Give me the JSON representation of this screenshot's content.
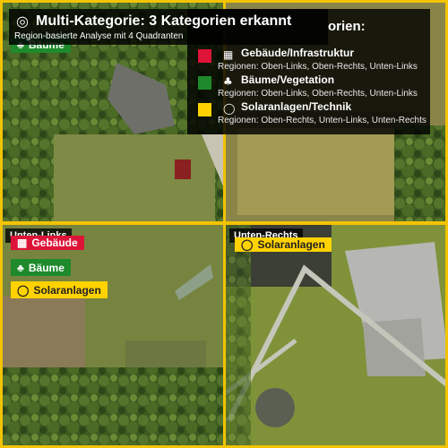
{
  "banner": {
    "title": "Multi-Kategorie: 3 Kategorien erkannt",
    "subtitle": "Region-basierte Analyse mit 4 Quadranten",
    "icon": "target-icon"
  },
  "legend": {
    "heading": "orien:",
    "items": [
      {
        "name": "Gebäude/Infrastruktur",
        "regions": "Regionen: Oben-Links, Oben-Rechts, Unten-Links",
        "color": "#dd1438",
        "icon": "building-icon"
      },
      {
        "name": "Bäume/Vegetation",
        "regions": "Regionen: Oben-Links, Oben-Rechts, Unten-Links",
        "color": "#1e8a2c",
        "icon": "tree-icon"
      },
      {
        "name": "Solaranlagen/Technik",
        "regions": "Regionen: Oben-Rechts, Unten-Links, Unten-Rechts",
        "color": "#ffd200",
        "icon": "solar-icon"
      }
    ]
  },
  "quadrants": {
    "top_left": {
      "chip_label": "Bäume"
    },
    "bottom_left": {
      "label": "Unten-Links",
      "chips": [
        "Gebäude",
        "Bäume",
        "Solaranlagen"
      ]
    },
    "bottom_right": {
      "label": "Unten-Rechts",
      "chips": [
        "Solaranlagen"
      ]
    }
  },
  "colors": {
    "frame": "#f2c300",
    "building": "#dd1438",
    "tree": "#1e8a2c",
    "solar": "#ffd200"
  }
}
